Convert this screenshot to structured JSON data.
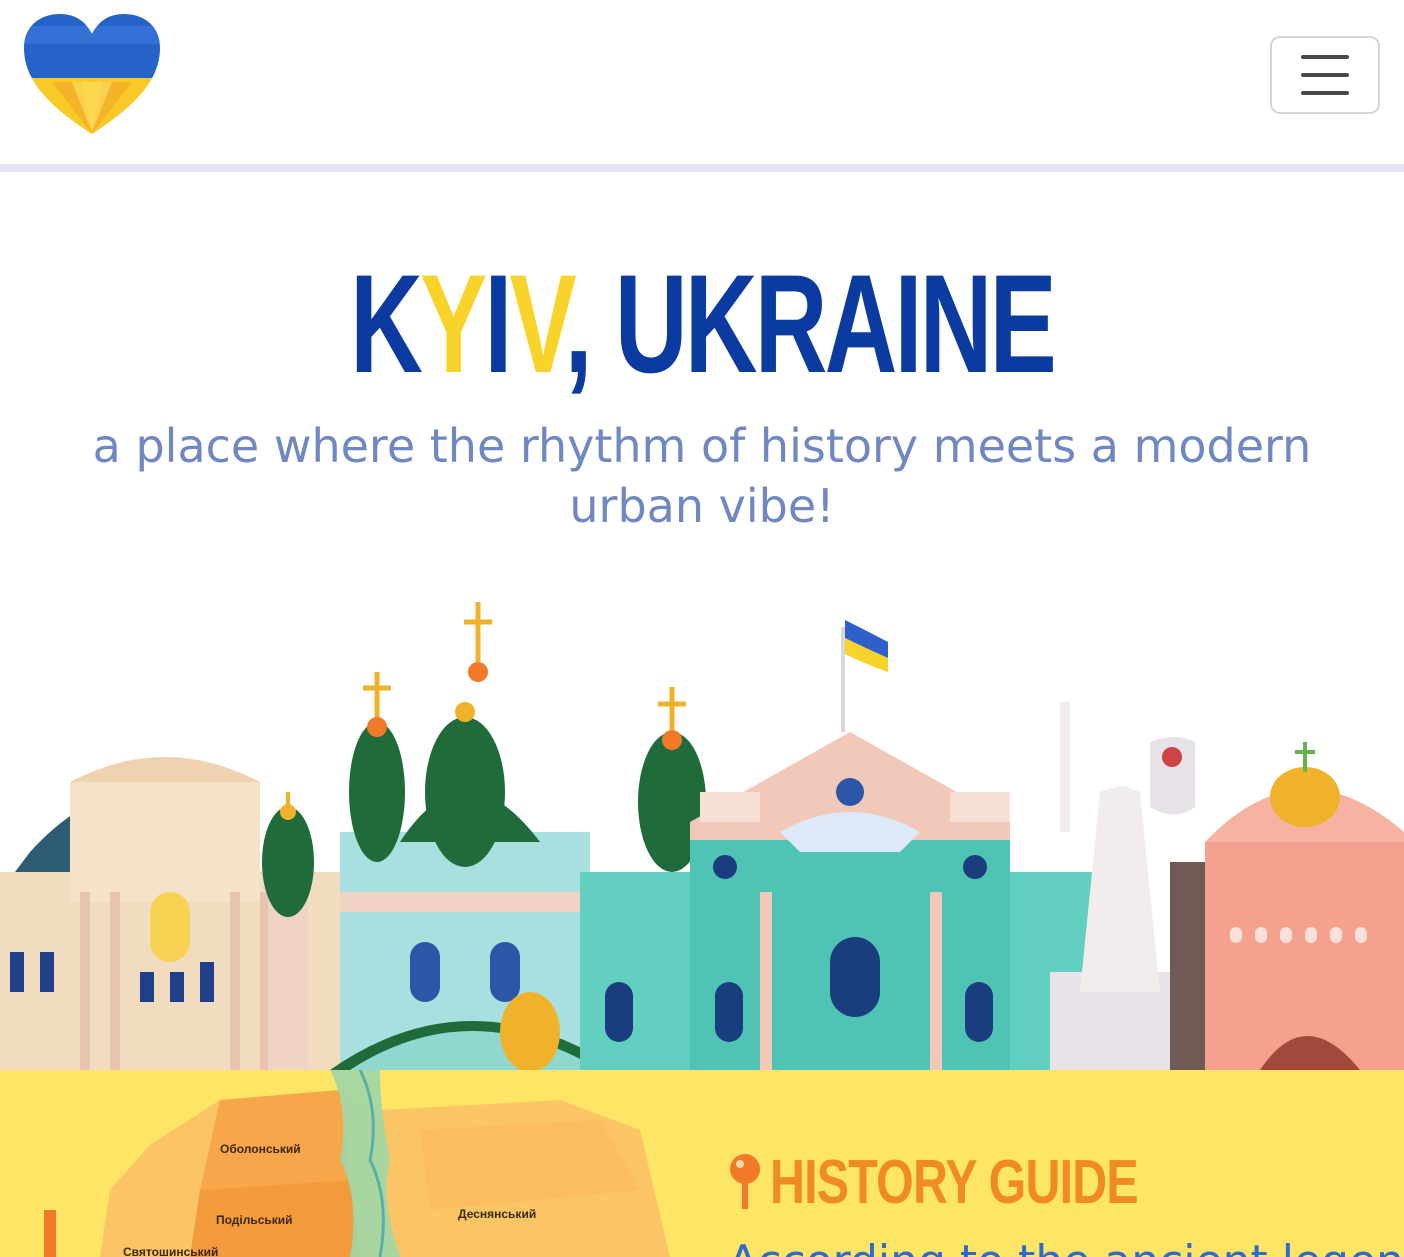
{
  "header": {
    "logo_icon": "ukraine-heart-icon",
    "menu_icon": "hamburger-menu-icon"
  },
  "hero": {
    "title_k": "K",
    "title_y": "Y",
    "title_i": "I",
    "title_v": "V",
    "title_rest": ", UKRAINE",
    "subtitle": "a place where the rhythm of history meets a modern urban vibe!"
  },
  "colors": {
    "brand_blue": "#0b3aa0",
    "brand_yellow": "#f8d42a",
    "subtitle": "#6f87c2",
    "section_bg": "#ffe566",
    "accent_orange": "#f08a24",
    "link_blue": "#2f6ad0"
  },
  "history": {
    "pin_icon": "map-pin-icon",
    "title": "HISTORY GUIDE",
    "intro": "According to the ancient legend"
  },
  "map": {
    "districts": [
      "Оболонський",
      "Подільський",
      "Деснянський",
      "Святошинський"
    ]
  }
}
